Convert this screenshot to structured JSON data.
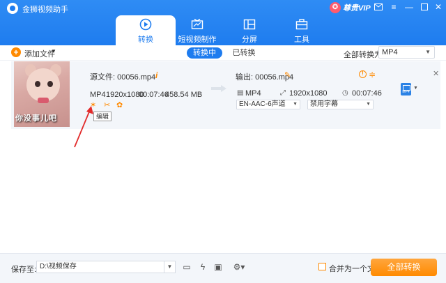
{
  "app": {
    "title": "金狮视频助手"
  },
  "vip": {
    "label": "尊贵VIP"
  },
  "window_controls": [
    "mail-icon",
    "menu-icon",
    "minimize-icon",
    "maximize-icon",
    "close-icon"
  ],
  "nav_tabs": [
    {
      "label": "转换",
      "icon": "convert-icon",
      "active": true
    },
    {
      "label": "短视频制作",
      "icon": "short-video-icon",
      "active": false
    },
    {
      "label": "分屏",
      "icon": "split-screen-icon",
      "active": false
    },
    {
      "label": "工具",
      "icon": "toolbox-icon",
      "active": false
    }
  ],
  "toolbar": {
    "add_file": "添加文件",
    "seg_converting": "转换中",
    "seg_converted": "已转换",
    "convert_all_to": "全部转换为:",
    "format": "MP4"
  },
  "file": {
    "thumb_subtitle": "你没事儿吧",
    "source": "源文件:  00056.mp4",
    "format": "MP4",
    "resolution": "1920x1080",
    "duration": "00:07:46",
    "size": "458.54 MB",
    "output": "输出:  00056.mp4",
    "out_format": "MP4",
    "out_resolution": "1920x1080",
    "out_duration": "00:07:46",
    "audio": "EN-AAC-6声道",
    "subtitle": "禁用字幕",
    "format_badge": "MP4",
    "tooltip": "编辑"
  },
  "footer": {
    "save_to": "保存至:",
    "path": "D:\\视频保存",
    "merge": "合并为一个文件",
    "convert_all": "全部转换"
  },
  "colors": {
    "brand": "#1e7cef",
    "accent": "#ff8a00"
  }
}
